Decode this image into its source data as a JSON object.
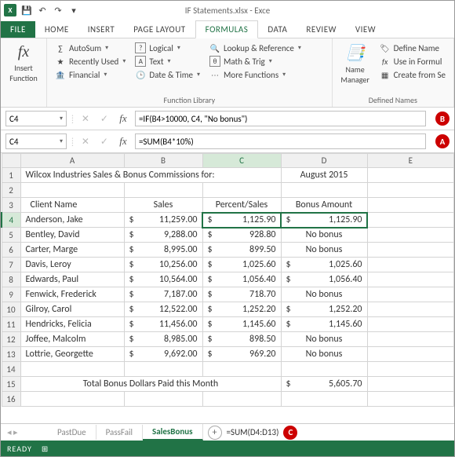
{
  "title": "IF Statements.xlsx - Exce",
  "tabs": [
    "FILE",
    "HOME",
    "INSERT",
    "PAGE LAYOUT",
    "FORMULAS",
    "DATA",
    "REVIEW",
    "VIEW"
  ],
  "active_tab": "FORMULAS",
  "ribbon": {
    "insert_function": "Insert\nFunction",
    "library": {
      "autosum": "AutoSum",
      "recent": "Recently Used",
      "financial": "Financial",
      "logical": "Logical",
      "text": "Text",
      "datetime": "Date & Time",
      "lookup": "Lookup & Reference",
      "mathtrig": "Math & Trig",
      "more": "More Functions",
      "label": "Function Library"
    },
    "names": {
      "manager": "Name\nManager",
      "define": "Define Name",
      "use": "Use in Formul",
      "create": "Create from Se",
      "label": "Defined Names"
    }
  },
  "fbar1": {
    "ref": "C4",
    "formula": "=IF(B4>10000, C4, \"No bonus\")",
    "badge": "B"
  },
  "fbar2": {
    "ref": "C4",
    "formula": "=SUM(B4*10%)",
    "badge": "A"
  },
  "cols": [
    "A",
    "B",
    "C",
    "D",
    "E"
  ],
  "title_row": {
    "text": "Wilcox Industries Sales & Bonus Commissions for:",
    "date": "August 2015"
  },
  "headers": {
    "a": "Client Name",
    "b": "Sales",
    "c": "Percent/Sales",
    "d": "Bonus Amount"
  },
  "rows": [
    {
      "n": 4,
      "name": "Anderson, Jake",
      "sales": "11,259.00",
      "pct": "1,125.90",
      "bonus": "1,125.90",
      "has": true
    },
    {
      "n": 5,
      "name": "Bentley, David",
      "sales": "9,288.00",
      "pct": "928.80",
      "bonus": "No bonus",
      "has": false
    },
    {
      "n": 6,
      "name": "Carter, Marge",
      "sales": "8,995.00",
      "pct": "899.50",
      "bonus": "No bonus",
      "has": false
    },
    {
      "n": 7,
      "name": "Davis, Leroy",
      "sales": "10,256.00",
      "pct": "1,025.60",
      "bonus": "1,025.60",
      "has": true
    },
    {
      "n": 8,
      "name": "Edwards, Paul",
      "sales": "10,564.00",
      "pct": "1,056.40",
      "bonus": "1,056.40",
      "has": true
    },
    {
      "n": 9,
      "name": "Fenwick, Frederick",
      "sales": "7,187.00",
      "pct": "718.70",
      "bonus": "No bonus",
      "has": false
    },
    {
      "n": 10,
      "name": "Gilroy, Carol",
      "sales": "12,522.00",
      "pct": "1,252.20",
      "bonus": "1,252.20",
      "has": true
    },
    {
      "n": 11,
      "name": "Hendricks, Felicia",
      "sales": "11,456.00",
      "pct": "1,145.60",
      "bonus": "1,145.60",
      "has": true
    },
    {
      "n": 12,
      "name": "Joffee, Malcolm",
      "sales": "8,985.00",
      "pct": "898.50",
      "bonus": "No bonus",
      "has": false
    },
    {
      "n": 13,
      "name": "Lottrie, Georgette",
      "sales": "9,692.00",
      "pct": "969.20",
      "bonus": "No bonus",
      "has": false
    }
  ],
  "total_row": {
    "label": "Total Bonus Dollars Paid this Month",
    "value": "5,605.70"
  },
  "sheets": {
    "tabs": [
      "PastDue",
      "PassFail",
      "SalesBonus"
    ],
    "active": "SalesBonus",
    "formula": "=SUM(D4:D13)",
    "badge": "C"
  },
  "status": "READY",
  "chart_data": {
    "type": "table",
    "title": "Wilcox Industries Sales & Bonus Commissions for: August 2015",
    "columns": [
      "Client Name",
      "Sales",
      "Percent/Sales",
      "Bonus Amount"
    ],
    "data": [
      [
        "Anderson, Jake",
        11259.0,
        1125.9,
        1125.9
      ],
      [
        "Bentley, David",
        9288.0,
        928.8,
        "No bonus"
      ],
      [
        "Carter, Marge",
        8995.0,
        899.5,
        "No bonus"
      ],
      [
        "Davis, Leroy",
        10256.0,
        1025.6,
        1025.6
      ],
      [
        "Edwards, Paul",
        10564.0,
        1056.4,
        1056.4
      ],
      [
        "Fenwick, Frederick",
        7187.0,
        718.7,
        "No bonus"
      ],
      [
        "Gilroy, Carol",
        12522.0,
        1252.2,
        1252.2
      ],
      [
        "Hendricks, Felicia",
        11456.0,
        1145.6,
        1145.6
      ],
      [
        "Joffee, Malcolm",
        8985.0,
        898.5,
        "No bonus"
      ],
      [
        "Lottrie, Georgette",
        9692.0,
        969.2,
        "No bonus"
      ]
    ],
    "total_bonus": 5605.7
  }
}
